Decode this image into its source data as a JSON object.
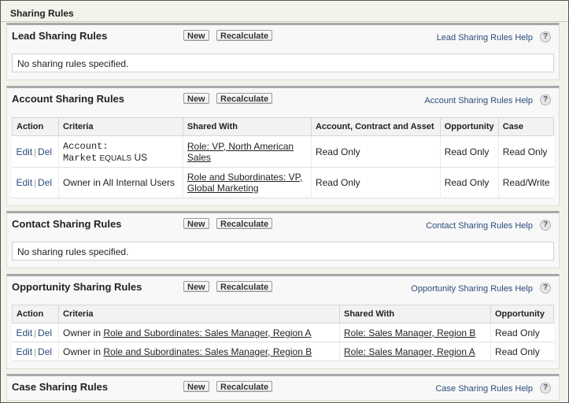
{
  "page": {
    "title": "Sharing Rules"
  },
  "buttons": {
    "new": "New",
    "recalculate": "Recalculate"
  },
  "help_icon_glyph": "?",
  "empty_text": "No sharing rules specified.",
  "sections": {
    "lead": {
      "title": "Lead Sharing Rules",
      "help": "Lead Sharing Rules Help"
    },
    "account": {
      "title": "Account Sharing Rules",
      "help": "Account Sharing Rules Help",
      "columns": [
        "Action",
        "Criteria",
        "Shared With",
        "Account, Contract and Asset",
        "Opportunity",
        "Case"
      ],
      "rows": [
        {
          "edit": "Edit",
          "del": "Del",
          "criteria_line1": "Account:",
          "criteria_field": "Market",
          "criteria_op": "EQUALS",
          "criteria_value": "US",
          "shared_with": "Role: VP, North American Sales",
          "account_access": "Read Only",
          "opportunity_access": "Read Only",
          "case_access": "Read Only"
        },
        {
          "edit": "Edit",
          "del": "Del",
          "criteria": "Owner in All Internal Users",
          "shared_with": "Role and Subordinates: VP, Global Marketing",
          "account_access": "Read Only",
          "opportunity_access": "Read Only",
          "case_access": "Read/Write"
        }
      ]
    },
    "contact": {
      "title": "Contact Sharing Rules",
      "help": "Contact Sharing Rules Help"
    },
    "opportunity": {
      "title": "Opportunity Sharing Rules",
      "help": "Opportunity Sharing Rules Help",
      "columns": [
        "Action",
        "Criteria",
        "Shared With",
        "Opportunity"
      ],
      "rows": [
        {
          "edit": "Edit",
          "del": "Del",
          "owner_prefix": "Owner in",
          "criteria_link": "Role and Subordinates: Sales Manager, Region A",
          "shared_with": "Role: Sales Manager, Region B",
          "access": "Read Only"
        },
        {
          "edit": "Edit",
          "del": "Del",
          "owner_prefix": "Owner in",
          "criteria_link": "Role and Subordinates: Sales Manager, Region B",
          "shared_with": "Role: Sales Manager, Region A",
          "access": "Read Only"
        }
      ]
    },
    "case": {
      "title": "Case Sharing Rules",
      "help": "Case Sharing Rules Help"
    }
  }
}
